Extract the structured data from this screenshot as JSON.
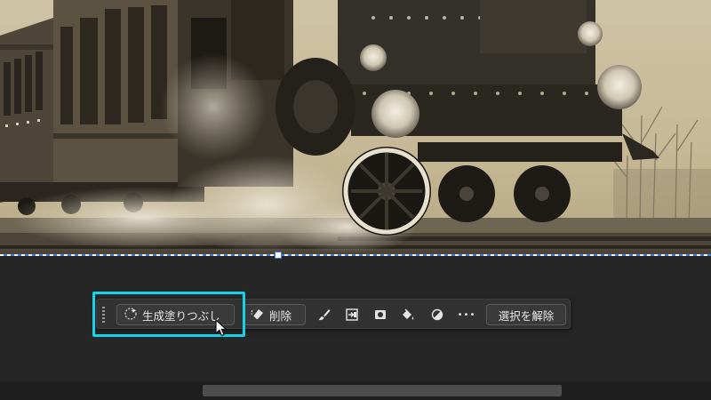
{
  "canvas": {
    "image_subject": "steam-locomotive-photo"
  },
  "taskbar": {
    "generative_fill_label": "生成塗りつぶし",
    "delete_label": "削除",
    "more_label": "•••",
    "deselect_label": "選択を解除",
    "icons": [
      "sparkle-icon",
      "eraser-icon",
      "brush-icon",
      "transform-icon",
      "mask-icon",
      "fill-bucket-icon",
      "invert-icon",
      "more-icon"
    ]
  },
  "colors": {
    "highlight": "#16d3e6",
    "selection_dash": "#3c7dd9",
    "panel_bg": "#262626"
  }
}
